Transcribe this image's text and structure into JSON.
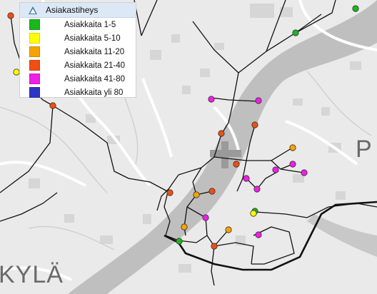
{
  "legend": {
    "title": "Asiakastiheys",
    "items": [
      {
        "label": "Asiakkaita 1-5",
        "color": "#19b81c"
      },
      {
        "label": "Asiakkaita 5-10",
        "color": "#ffff00"
      },
      {
        "label": "Asiakkaita 11-20",
        "color": "#f6a300"
      },
      {
        "label": "Asiakkaita 21-40",
        "color": "#f04e12"
      },
      {
        "label": "Asiakkaita 41-80",
        "color": "#f01ee6"
      },
      {
        "label": "Asiakkaita yli 80",
        "color": "#2c36c4"
      }
    ]
  },
  "map_labels": {
    "left": "KYLÄ",
    "right": "P"
  }
}
